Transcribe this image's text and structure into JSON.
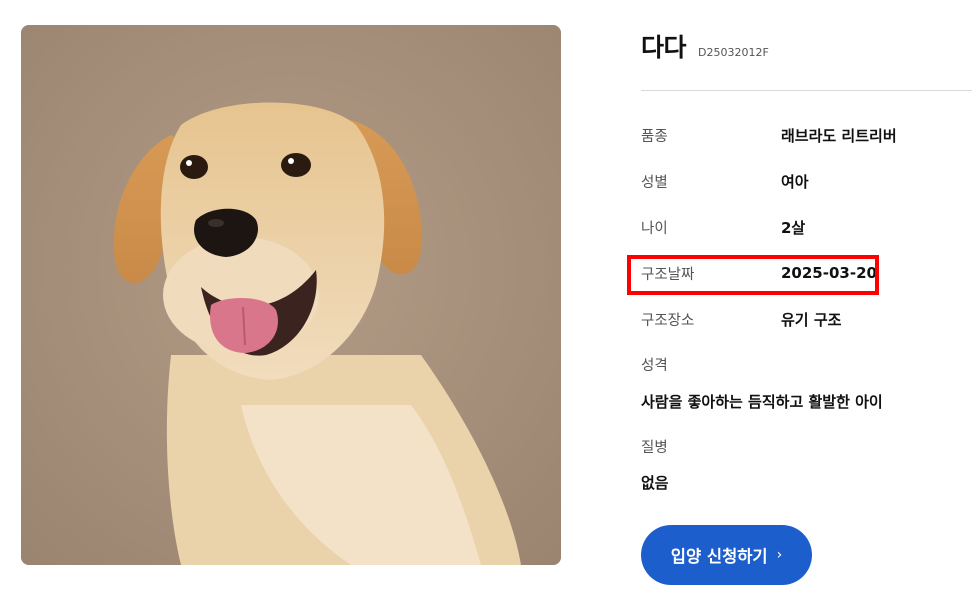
{
  "pet": {
    "name": "다다",
    "id": "D25032012F",
    "photo_icon": "labrador-retriever-photo"
  },
  "details": [
    {
      "label": "품종",
      "value": "래브라도 리트리버"
    },
    {
      "label": "성별",
      "value": "여아"
    },
    {
      "label": "나이",
      "value": "2살"
    },
    {
      "label": "구조날짜",
      "value": "2025-03-20"
    },
    {
      "label": "구조장소",
      "value": "유기 구조"
    }
  ],
  "personality": {
    "label": "성격",
    "value": "사람을 좋아하는 듬직하고 활발한 아이"
  },
  "disease": {
    "label": "질병",
    "value": "없음"
  },
  "adopt_button": {
    "label": "입양 신청하기",
    "icon": "chevron-right-icon"
  },
  "colors": {
    "button_bg": "#1c5fcc",
    "highlight_border": "#ff0000",
    "photo_bg": "#a8927c"
  }
}
